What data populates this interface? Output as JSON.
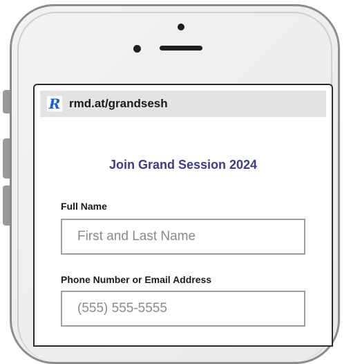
{
  "browser": {
    "url": "rmd.at/grandsesh",
    "logo_icon": "remind-r-logo-icon"
  },
  "form": {
    "title": "Join Grand Session 2024",
    "fields": [
      {
        "label": "Full Name",
        "placeholder": "First and Last Name",
        "value": ""
      },
      {
        "label": "Phone Number or Email Address",
        "placeholder": "(555) 555-5555",
        "value": ""
      }
    ]
  },
  "colors": {
    "title": "#3d3b8e",
    "logo": "#1e5bd8"
  }
}
